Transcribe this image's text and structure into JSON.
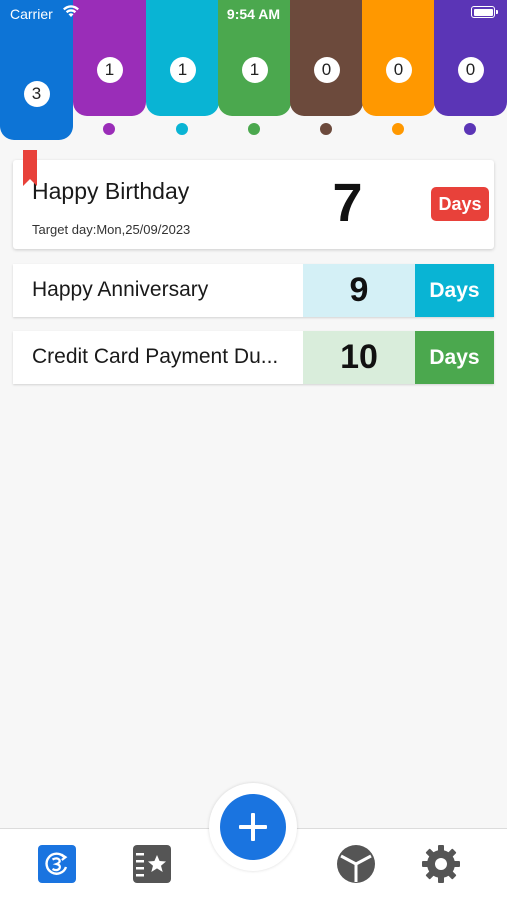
{
  "status_bar": {
    "carrier": "Carrier",
    "time": "9:54 AM"
  },
  "categories": [
    {
      "count": "3",
      "color": "#0d74d6",
      "active": true
    },
    {
      "count": "1",
      "color": "#9a2db8"
    },
    {
      "count": "1",
      "color": "#09b4d4"
    },
    {
      "count": "1",
      "color": "#4ba84e"
    },
    {
      "count": "0",
      "color": "#6c4a3c"
    },
    {
      "count": "0",
      "color": "#ff9800"
    },
    {
      "count": "0",
      "color": "#5b35b6"
    }
  ],
  "events": [
    {
      "title": "Happy Birthday",
      "target": "Target day:Mon,25/09/2023",
      "days": "7",
      "unit": "Days",
      "accent": "#e8413a"
    },
    {
      "title": "Happy Anniversary",
      "days": "9",
      "unit": "Days",
      "accent": "#09b4d4",
      "tint": "#d4f0f6"
    },
    {
      "title": "Credit Card Payment Du...",
      "days": "10",
      "unit": "Days",
      "accent": "#4ba84e",
      "tint": "#d9eddb"
    }
  ],
  "bottom_nav": {
    "icons": [
      "countdown-icon",
      "favorites-icon",
      "add-icon",
      "clock-icon",
      "settings-icon"
    ]
  }
}
